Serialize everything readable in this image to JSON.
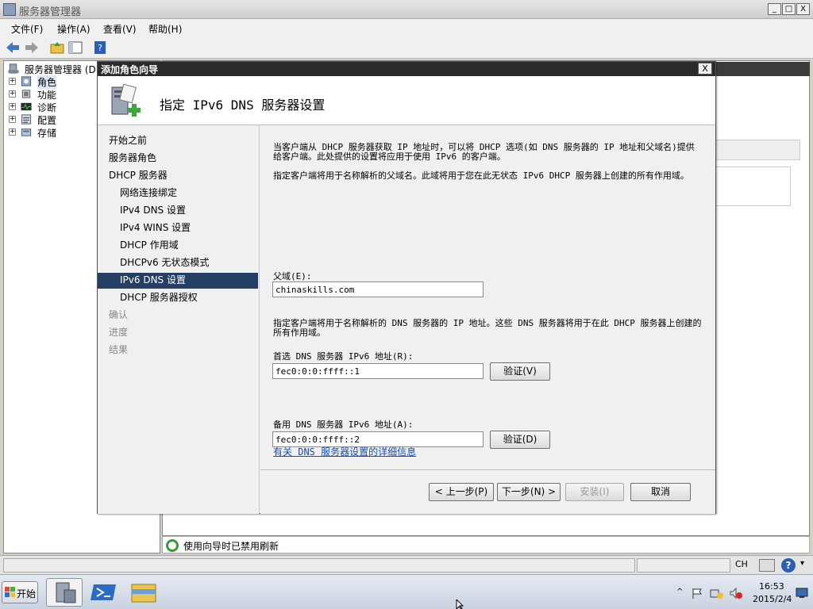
{
  "window": {
    "title": "服务器管理器",
    "controls": {
      "minimize": "_",
      "maximize": "□",
      "close": "X"
    }
  },
  "menu": {
    "items": [
      "文件(F)",
      "操作(A)",
      "查看(V)",
      "帮助(H)"
    ]
  },
  "tree": {
    "root": "服务器管理器 (DI",
    "items": [
      "角色",
      "功能",
      "诊断",
      "配置",
      "存储"
    ],
    "expander": "+"
  },
  "status": {
    "message": "使用向导时已禁用刷新"
  },
  "bottom": {
    "lang": "CH",
    "help": "?"
  },
  "taskbar": {
    "start": "开始",
    "time": "16:53",
    "date": "2015/2/4"
  },
  "dialog": {
    "title": "添加角色向导",
    "close": "X",
    "header_title": "指定 IPv6 DNS 服务器设置",
    "nav": [
      {
        "label": "开始之前",
        "state": "normal",
        "indent": 0
      },
      {
        "label": "服务器角色",
        "state": "normal",
        "indent": 0
      },
      {
        "label": "DHCP 服务器",
        "state": "normal",
        "indent": 0
      },
      {
        "label": "网络连接绑定",
        "state": "normal",
        "indent": 1
      },
      {
        "label": "IPv4 DNS 设置",
        "state": "normal",
        "indent": 1
      },
      {
        "label": "IPv4 WINS 设置",
        "state": "normal",
        "indent": 1
      },
      {
        "label": "DHCP 作用域",
        "state": "normal",
        "indent": 1
      },
      {
        "label": "DHCPv6 无状态模式",
        "state": "normal",
        "indent": 1
      },
      {
        "label": "IPv6 DNS 设置",
        "state": "selected",
        "indent": 1
      },
      {
        "label": "DHCP 服务器授权",
        "state": "normal",
        "indent": 1
      },
      {
        "label": "确认",
        "state": "dim",
        "indent": 0
      },
      {
        "label": "进度",
        "state": "dim",
        "indent": 0
      },
      {
        "label": "结果",
        "state": "dim",
        "indent": 0
      }
    ],
    "para1": "当客户端从 DHCP 服务器获取 IP 地址时，可以将 DHCP 选项(如 DNS 服务器的 IP 地址和父域名)提供给客户端。此处提供的设置将应用于使用 IPv6 的客户端。",
    "para2": "指定客户端将用于名称解析的父域名。此域将用于您在此无状态 IPv6 DHCP 服务器上创建的所有作用域。",
    "parent_domain_label": "父域(E):",
    "parent_domain_value": "chinaskills.com",
    "para3": "指定客户端将用于名称解析的 DNS 服务器的 IP 地址。这些 DNS 服务器将用于在此 DHCP 服务器上创建的所有作用域。",
    "preferred_label": "首选 DNS 服务器 IPv6 地址(R):",
    "preferred_value": "fec0:0:0:ffff::1",
    "verify1": "验证(V)",
    "alternate_label": "备用 DNS 服务器 IPv6 地址(A):",
    "alternate_value": "fec0:0:0:ffff::2",
    "verify2": "验证(D)",
    "help_link": "有关 DNS 服务器设置的详细信息",
    "buttons": {
      "back": "< 上一步(P)",
      "next": "下一步(N) >",
      "install": "安装(I)",
      "cancel": "取消"
    }
  },
  "colors": {
    "nav_selected": "#243e64",
    "link": "#1a4ea8",
    "dialog_title": "#2b2b2b"
  }
}
